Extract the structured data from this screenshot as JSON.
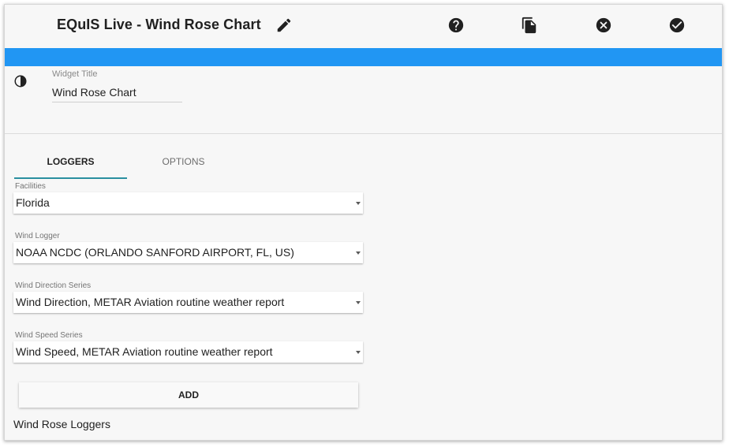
{
  "header": {
    "title": "EQuIS Live - Wind Rose Chart",
    "icons": [
      "edit-icon",
      "help-icon",
      "copy-icon",
      "cancel-icon",
      "confirm-icon"
    ]
  },
  "colors": {
    "accent_bar": "#2196f3",
    "tab_underline": "#2a8fa0"
  },
  "widget_title": {
    "label": "Widget Title",
    "value": "Wind Rose Chart",
    "icon": "contrast-icon"
  },
  "tabs": [
    {
      "label": "LOGGERS",
      "active": true
    },
    {
      "label": "OPTIONS",
      "active": false
    }
  ],
  "fields": {
    "facilities": {
      "label": "Facilities",
      "value": "Florida"
    },
    "wind_logger": {
      "label": "Wind Logger",
      "value": "NOAA NCDC (ORLANDO SANFORD AIRPORT, FL, US)"
    },
    "wind_direction": {
      "label": "Wind Direction Series",
      "value": "Wind Direction, METAR Aviation routine weather report"
    },
    "wind_speed": {
      "label": "Wind Speed Series",
      "value": "Wind Speed, METAR Aviation routine weather report"
    }
  },
  "add_button": {
    "label": "ADD"
  },
  "loggers_section": {
    "label": "Wind Rose Loggers"
  }
}
